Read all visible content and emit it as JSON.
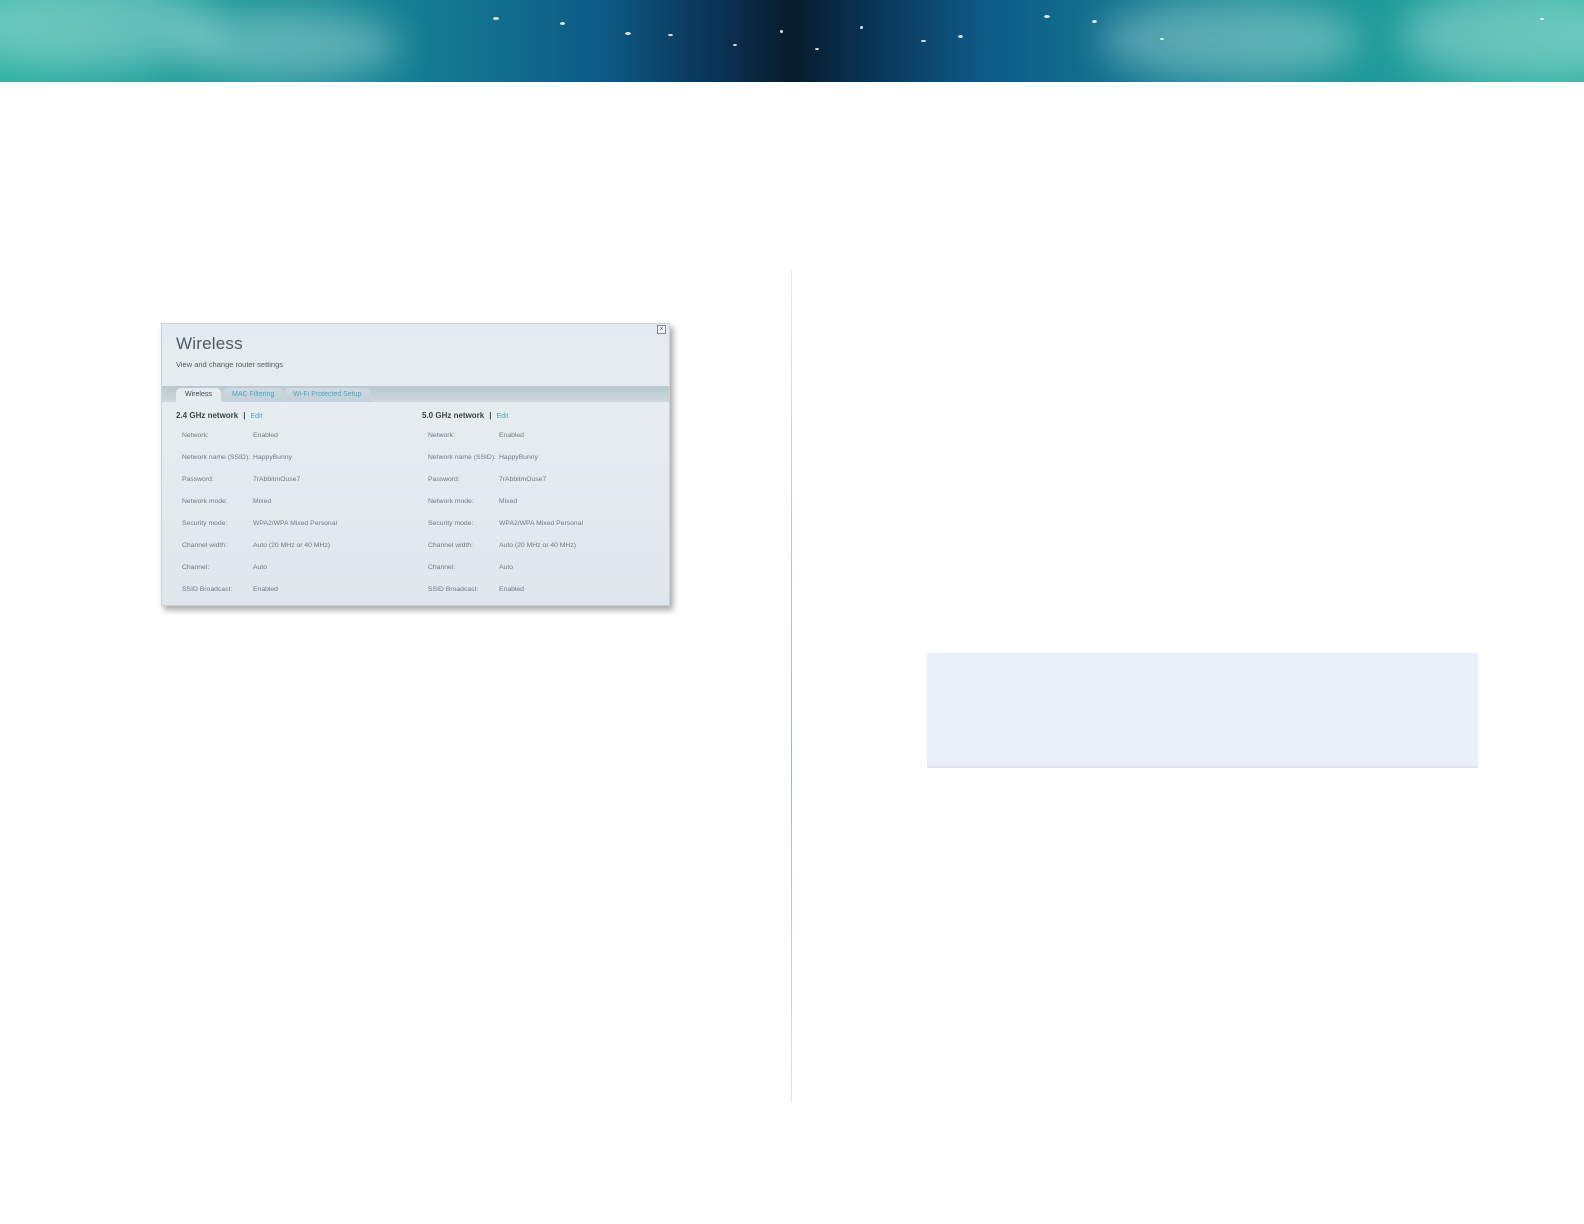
{
  "dialog": {
    "title": "Wireless",
    "subtitle": "View and change router settings",
    "close_glyph": "×",
    "tabs": [
      {
        "label": "Wireless",
        "active": true
      },
      {
        "label": "MAC Filtering",
        "active": false
      },
      {
        "label": "Wi-Fi Protected Setup",
        "active": false
      }
    ],
    "edit_label": "Edit",
    "separator": "|",
    "networks": [
      {
        "heading": "2.4 GHz network",
        "rows": [
          {
            "label": "Network:",
            "value": "Enabled"
          },
          {
            "label": "Network name (SSID):",
            "value": "HappyBunny"
          },
          {
            "label": "Password:",
            "value": "7rAbbitmOuse7"
          },
          {
            "label": "Network mode:",
            "value": "Mixed"
          },
          {
            "label": "Security mode:",
            "value": "WPA2/WPA Mixed Personal"
          },
          {
            "label": "Channel width:",
            "value": "Auto (20 MHz or 40 MHz)"
          },
          {
            "label": "Channel:",
            "value": "Auto"
          },
          {
            "label": "SSID Broadcast:",
            "value": "Enabled"
          }
        ]
      },
      {
        "heading": "5.0 GHz network",
        "rows": [
          {
            "label": "Network:",
            "value": "Enabled"
          },
          {
            "label": "Network name (SSID):",
            "value": "HappyBunny"
          },
          {
            "label": "Password:",
            "value": "7rAbbitmOuse7"
          },
          {
            "label": "Network mode:",
            "value": "Mixed"
          },
          {
            "label": "Security mode:",
            "value": "WPA2/WPA Mixed Personal"
          },
          {
            "label": "Channel width:",
            "value": "Auto (20 MHz or 40 MHz)"
          },
          {
            "label": "Channel:",
            "value": "Auto"
          },
          {
            "label": "SSID Broadcast:",
            "value": "Enabled"
          }
        ]
      }
    ]
  },
  "colors": {
    "accent_link": "#4aa3c2",
    "note_box": "#e9eef8"
  }
}
